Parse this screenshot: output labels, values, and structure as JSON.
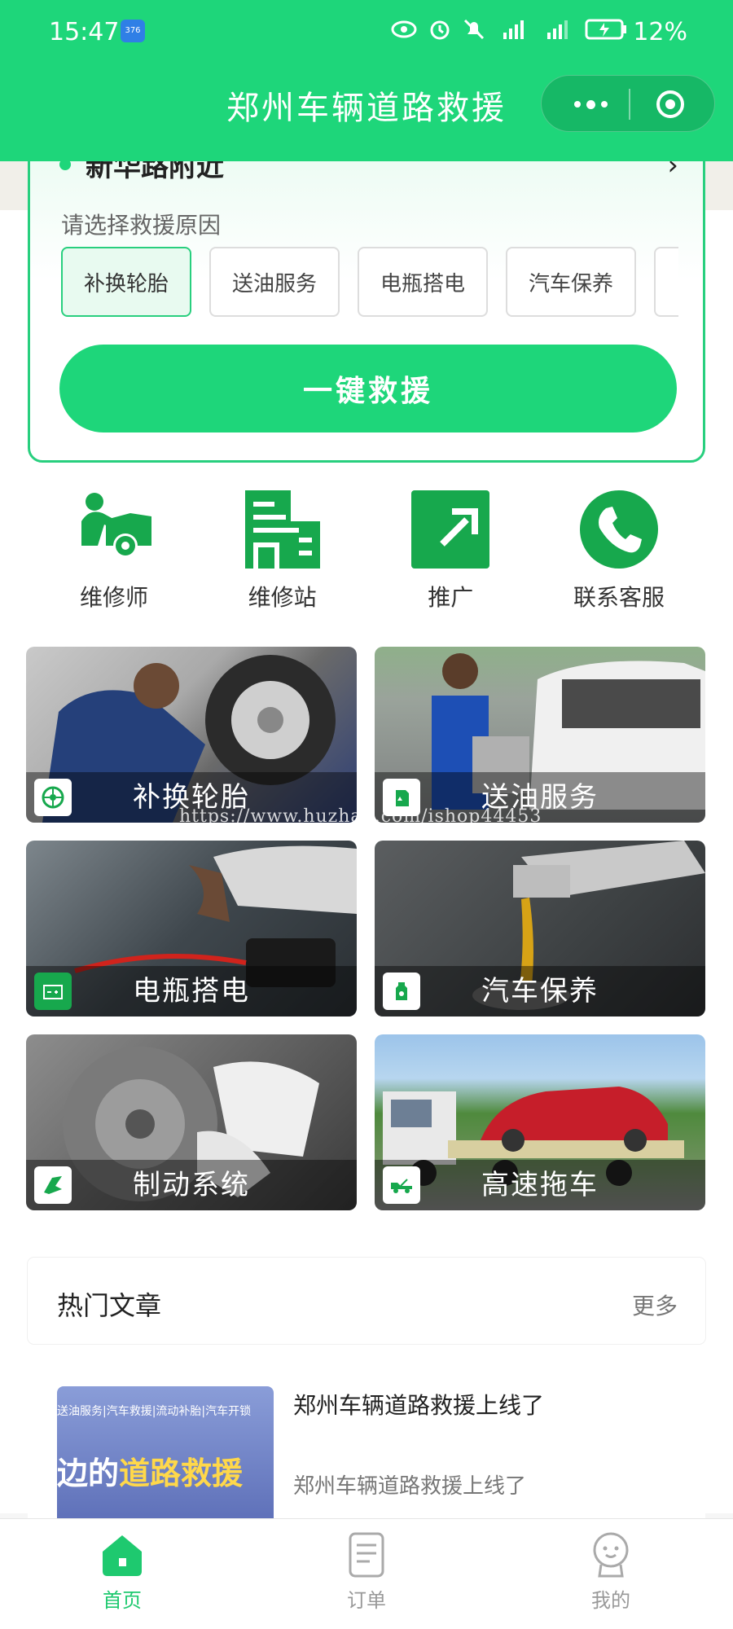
{
  "status_bar": {
    "time": "15:47",
    "badge": "376",
    "battery": "12%"
  },
  "header": {
    "title": "郑州车辆道路救援"
  },
  "rescue": {
    "location": "新华路附近",
    "reason_label": "请选择救援原因",
    "reasons": [
      "补换轮胎",
      "送油服务",
      "电瓶搭电",
      "汽车保养"
    ],
    "button": "一键救援"
  },
  "quick_actions": [
    "维修师",
    "维修站",
    "推广",
    "联系客服"
  ],
  "services": [
    "补换轮胎",
    "送油服务",
    "电瓶搭电",
    "汽车保养",
    "制动系统",
    "高速拖车"
  ],
  "watermark": "https://www.huzhan.com/ishop44453",
  "articles_section": {
    "title": "热门文章",
    "more": "更多"
  },
  "articles": [
    {
      "thumb_top": "送油服务|汽车救援|流动补胎|汽车开锁",
      "thumb_main_prefix": "边的",
      "thumb_main_highlight": "道路救援",
      "title": "郑州车辆道路救援上线了",
      "desc": "郑州车辆道路救援上线了"
    }
  ],
  "tabs": [
    "首页",
    "订单",
    "我的"
  ],
  "colors": {
    "primary": "#1ed67a",
    "primary_dark": "#16b866",
    "icon_green": "#17a84d"
  }
}
